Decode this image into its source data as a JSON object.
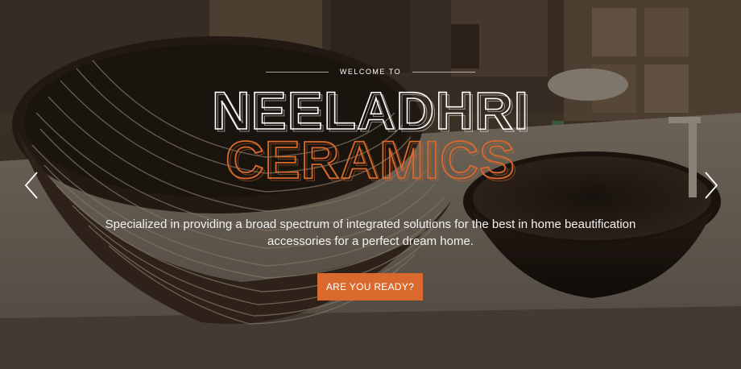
{
  "hero": {
    "welcome": "WELCOME TO",
    "title_line1": "NEELADHRI",
    "title_line2": "CERAMICS",
    "subtitle": "Specialized in providing a broad spectrum of integrated solutions for the best in home beautification accessories for a perfect dream home.",
    "cta_label": "ARE YOU READY?"
  },
  "colors": {
    "accent": "#d9692d",
    "title_white": "#ffffff"
  },
  "icons": {
    "prev": "chevron-left-icon",
    "next": "chevron-right-icon"
  }
}
